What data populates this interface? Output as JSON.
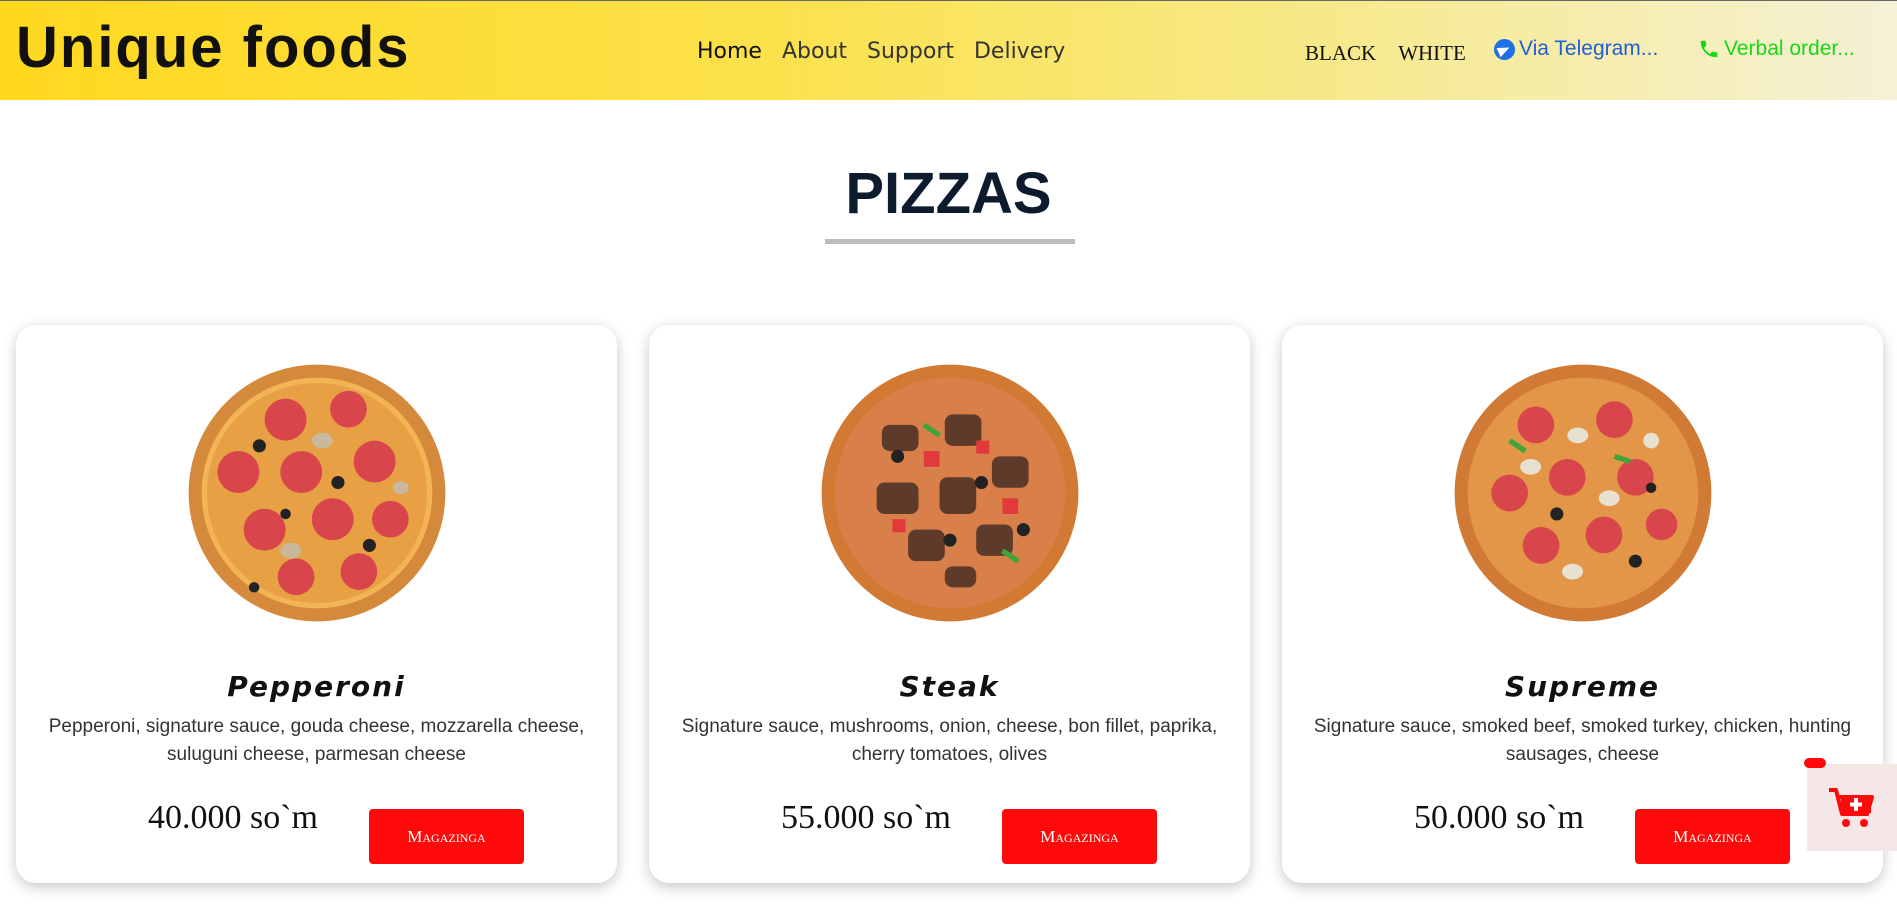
{
  "header": {
    "logo": "Unique foods",
    "nav": [
      "Home",
      "About",
      "Support",
      "Delivery"
    ],
    "theme": [
      "BLACK",
      "WHITE"
    ],
    "telegram": "Via Telegram...",
    "phone": "Verbal order...",
    "colors": {
      "telegram": "#1f5fd6",
      "phone": "#16d916"
    }
  },
  "section": {
    "title": "PIZZAS"
  },
  "products": [
    {
      "name": "Pepperoni",
      "description": "Pepperoni, signature sauce, gouda cheese, mozzarella cheese, suluguni cheese, parmesan cheese",
      "price": "40.000 so`m",
      "button": "Magazinga",
      "image": "pepperoni-pizza-image"
    },
    {
      "name": "Steak",
      "description": "Signature sauce, mushrooms, onion, cheese, bon fillet, paprika, cherry tomatoes, olives",
      "price": "55.000 so`m",
      "button": "Magazinga",
      "image": "steak-pizza-image"
    },
    {
      "name": "Supreme",
      "description": "Signature sauce, smoked beef, smoked turkey, chicken, hunting sausages, cheese",
      "price": "50.000 so`m",
      "button": "Magazinga",
      "image": "supreme-pizza-image"
    }
  ],
  "accent": "#ff0a0a",
  "cart": {
    "icon": "cart-plus-icon"
  }
}
